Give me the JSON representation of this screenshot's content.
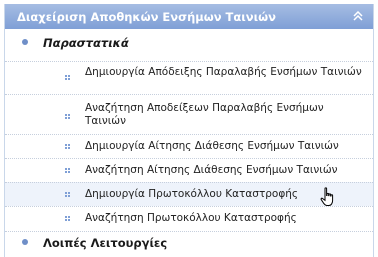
{
  "header": {
    "title": "Διαχείριση Αποθηκών Ενσήμων Ταινιών",
    "toggle_icon": "chevron-up-double-icon"
  },
  "sections": [
    {
      "label": "Παραστατικά",
      "bullet_icon": "bullet-icon"
    },
    {
      "label": "Λοιπές Λειτουργίες",
      "bullet_icon": "bullet-icon"
    }
  ],
  "items": [
    {
      "label": "Δημιουργία Απόδειξης Παραλαβής Ενσήμων Ταινιών"
    },
    {
      "label": "Αναζήτηση Αποδείξεων Παραλαβής Ενσήμων Ταινιών"
    },
    {
      "label": "Δημιουργία Αίτησης Διάθεσης Ενσήμων Ταινιών"
    },
    {
      "label": "Αναζήτηση Αίτησης Διάθεσης Ενσήμων Ταινιών"
    },
    {
      "label": "Δημιουργία Πρωτοκόλλου Καταστροφής"
    },
    {
      "label": "Αναζήτηση Πρωτοκόλλου Καταστροφής"
    }
  ],
  "colors": {
    "header": "#7f9fd6",
    "bullet": "#6f8fc8",
    "hover_row": "#eef3fb"
  },
  "cursor_icon": "hand-pointer-icon"
}
